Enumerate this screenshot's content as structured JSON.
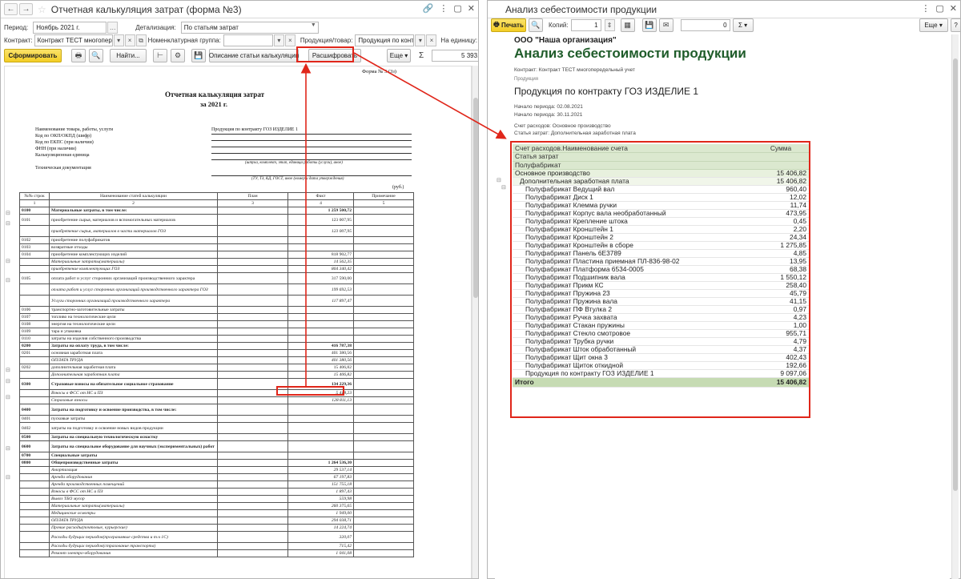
{
  "left_window": {
    "title": "Отчетная калькуляция затрат (форма №3)",
    "period_label": "Период:",
    "period_value": "Ноябрь 2021 г.",
    "detail_label": "Детализация:",
    "detail_value": "По статьям затрат",
    "contract_label": "Контракт:",
    "contract_value": "Контракт ТЕСТ многоперед",
    "nomgroup_label": "Номенклатурная группа:",
    "nomgroup_value": "",
    "product_label": "Продукция/товар:",
    "product_value": "Продукция по контра",
    "per_unit_label": "На единицу:",
    "generate_button": "Сформировать",
    "find_button": "Найти...",
    "desc_button": "Описание статьи калькуляции",
    "decode_button": "Расшифровать",
    "more_button": "Еще",
    "sum_value": "5 393,70",
    "doc": {
      "form_no": "Форма № 3 (3з)",
      "title1": "Отчетная калькуляция затрат",
      "title2": "за 2021 г.",
      "labels": [
        "Наименование товара, работы, услуги",
        "Код по ОКП/ОКПД (шифр)",
        "Код по ЕКПС (при наличии)",
        "ФНН (при наличии)",
        "Калькуляционная единица",
        "Техническая документация"
      ],
      "product_name": "Продукция по контракту ГОЗ ИЗДЕЛИЕ 1",
      "hint1": "(штука, комплект, этап, единица работы (услуги), иное)",
      "hint2": "(ТУ, ТЗ, КД, ГОСТ, иное (номер и дата утверждения)",
      "rub": "(руб.)",
      "headers": [
        "№№ строк",
        "Наименование статей калькуляции",
        "План",
        "Факт",
        "Примечание"
      ],
      "colnums": [
        "1",
        "2",
        "3",
        "4",
        "5"
      ],
      "rows": [
        {
          "c": "0100",
          "n": "Материальные затраты, в том числе:",
          "f": "1 259 500,72",
          "s": "b"
        },
        {
          "c": "0101",
          "n": "приобретение сырья, материалов и вспомогательных материалов",
          "f": "123 007,95",
          "s": ""
        },
        {
          "c": "",
          "n": "приобретение сырья, материалов в части материалов ГОЗ",
          "f": "123 007,95",
          "s": "i"
        },
        {
          "c": "0102",
          "n": "приобретение полуфабрикатов",
          "f": "",
          "s": ""
        },
        {
          "c": "0103",
          "n": "возвратные отходы",
          "f": "",
          "s": ""
        },
        {
          "c": "0104",
          "n": "приобретение комплектующих изделий",
          "f": "818 902,77",
          "s": ""
        },
        {
          "c": "",
          "n": "Материальные затраты(материалы)",
          "f": "14 562,35",
          "s": "i"
        },
        {
          "c": "",
          "n": "приобретение комплектующих ГОЗ",
          "f": "804 340,42",
          "s": "i"
        },
        {
          "c": "0105",
          "n": "оплата работ и услуг сторонних организаций производственного характера",
          "f": "317 590,00",
          "s": ""
        },
        {
          "c": "",
          "n": "оплата работ и услуг сторонних организаций производственного характера ГОЗ",
          "f": "199 692,53",
          "s": "i"
        },
        {
          "c": "",
          "n": "Услуги сторонних организаций производственного характера",
          "f": "117 897,47",
          "s": "i"
        },
        {
          "c": "0106",
          "n": "транспортно-заготовительные затраты",
          "f": "",
          "s": ""
        },
        {
          "c": "0107",
          "n": "топливо на технологические цели",
          "f": "",
          "s": ""
        },
        {
          "c": "0108",
          "n": "энергия на технологические цели",
          "f": "",
          "s": ""
        },
        {
          "c": "0109",
          "n": "тара и упаковка",
          "f": "",
          "s": ""
        },
        {
          "c": "0110",
          "n": "затраты на изделия собственного производства",
          "f": "",
          "s": ""
        },
        {
          "c": "0200",
          "n": "Затраты на оплату труда, в том числе:",
          "f": "416 787,38",
          "s": "b"
        },
        {
          "c": "0201",
          "n": "основная заработная плата",
          "f": "401 380,56",
          "s": ""
        },
        {
          "c": "",
          "n": "ОПЛАТА ТРУДА",
          "f": "401 380,56",
          "s": "i"
        },
        {
          "c": "0202",
          "n": "дополнительная заработная плата",
          "f": "15 406,82",
          "s": ""
        },
        {
          "c": "",
          "n": "Дополнительная заработная плата",
          "f": "15 406,82",
          "s": "i"
        },
        {
          "c": "0300",
          "n": "Страховые взносы на обязательное социальное страхование",
          "f": "134 229,36",
          "s": "b"
        },
        {
          "c": "",
          "n": "Взносы в ФСС от НС и ПЗ",
          "f": "5 418,23",
          "s": "i"
        },
        {
          "c": "",
          "n": "Страховые взносы",
          "f": "128 811,13",
          "s": "i"
        },
        {
          "c": "0400",
          "n": "Затраты на подготовку и освоение производства, в том числе:",
          "f": "",
          "s": "b"
        },
        {
          "c": "0401",
          "n": "пусковые затраты",
          "f": "",
          "s": ""
        },
        {
          "c": "0402",
          "n": "затраты на подготовку и освоение новых видов продукции",
          "f": "",
          "s": ""
        },
        {
          "c": "0500",
          "n": "Затраты на специальную технологическую оснастку",
          "f": "",
          "s": "b"
        },
        {
          "c": "0600",
          "n": "Затраты на специальное оборудование для научных (экспериментальных) работ",
          "f": "",
          "s": "b"
        },
        {
          "c": "0700",
          "n": "Специальные затраты",
          "f": "",
          "s": "b"
        },
        {
          "c": "0800",
          "n": "Общепроизводственные затраты",
          "f": "1 264 536,30",
          "s": "b"
        },
        {
          "c": "",
          "n": "Амортизация",
          "f": "29 537,14",
          "s": "i"
        },
        {
          "c": "",
          "n": "Аренда оборудования",
          "f": "67 197,83",
          "s": "i"
        },
        {
          "c": "",
          "n": "Аренда производственных помещений",
          "f": "151 755,18",
          "s": "i"
        },
        {
          "c": "",
          "n": "Взносы в ФСС от НС и ПЗ",
          "f": "1 897,43",
          "s": "i"
        },
        {
          "c": "",
          "n": "Вывоз ТБО мусор",
          "f": "559,98",
          "s": "i"
        },
        {
          "c": "",
          "n": "Материальные затраты(материалы)",
          "f": "260 375,65",
          "s": "i"
        },
        {
          "c": "",
          "n": "Медицинские осмотры",
          "f": "1 949,00",
          "s": "i"
        },
        {
          "c": "",
          "n": "ОПЛАТА ТРУДА",
          "f": "294 038,71",
          "s": "i"
        },
        {
          "c": "",
          "n": "Прочие расходы(почтовые, курьерские)",
          "f": "14 224,74",
          "s": "i"
        },
        {
          "c": "",
          "n": "Расходы будущих периодов(программные средства и т.ч 1С)",
          "f": "320,07",
          "s": "i"
        },
        {
          "c": "",
          "n": "Расходы будущих периодов(страхование транспорта)",
          "f": "715,42",
          "s": "i"
        },
        {
          "c": "",
          "n": "Ремонт электро-оборудования",
          "f": "1 041,08",
          "s": "i"
        }
      ]
    }
  },
  "right_window": {
    "title": "Анализ себестоимости продукции",
    "print_button": "Печать",
    "copies_label": "Копий:",
    "copies_value": "1",
    "num_value": "0",
    "sigma": "Σ",
    "more_button": "Еще",
    "report": {
      "org": "ООО \"Наша организация\"",
      "title": "Анализ себестоимости продукции",
      "contract": "Контракт: Контракт ТЕСТ многопередельный учет",
      "product_caption": "Продукция",
      "product_name": "Продукция по контракту ГОЗ ИЗДЕЛИЕ 1",
      "period_start": "Начало периода: 02.08.2021",
      "period_end": "Начало периода: 30.11.2021",
      "account": "Счет расходов: Основное производство",
      "cost_item": "Статья затрат: Дополнительная заработная плата",
      "headers": [
        "Счет расходов.Наименование счета",
        "Статья затрат",
        "Полуфабрикат"
      ],
      "sum_header": "Сумма",
      "group1": {
        "name": "Основное производство",
        "sum": "15 406,82"
      },
      "group2": {
        "name": "Дополнительная заработная плата",
        "sum": "15 406,82"
      },
      "items": [
        {
          "n": "Полуфабрикат Ведущий вал",
          "s": "960,40"
        },
        {
          "n": "Полуфабрикат Диск 1",
          "s": "12,02"
        },
        {
          "n": "Полуфабрикат Клемма ручки",
          "s": "11,74"
        },
        {
          "n": "Полуфабрикат Корпус вала необработанный",
          "s": "473,95"
        },
        {
          "n": "Полуфабрикат Крепление штока",
          "s": "0,45"
        },
        {
          "n": "Полуфабрикат Кронштейн 1",
          "s": "2,20"
        },
        {
          "n": "Полуфабрикат Кронштейн 2",
          "s": "24,34"
        },
        {
          "n": "Полуфабрикат Кронштейн в сборе",
          "s": "1 275,85"
        },
        {
          "n": "Полуфабрикат Панель 6Е3789",
          "s": "4,85"
        },
        {
          "n": "Полуфабрикат Пластина приемная ПЛ-836-98-02",
          "s": "13,95"
        },
        {
          "n": "Полуфабрикат Платформа 6534-0005",
          "s": "68,38"
        },
        {
          "n": "Полуфабрикат Подшипник вала",
          "s": "1 550,12"
        },
        {
          "n": "Полуфабрикат Прикм КС",
          "s": "258,40"
        },
        {
          "n": "Полуфабрикат Пружина 23",
          "s": "45,79"
        },
        {
          "n": "Полуфабрикат Пружина вала",
          "s": "41,15"
        },
        {
          "n": "Полуфабрикат ПФ Втулка 2",
          "s": "0,97"
        },
        {
          "n": "Полуфабрикат Ручка захвата",
          "s": "4,23"
        },
        {
          "n": "Полуфабрикат Стакан пружины",
          "s": "1,00"
        },
        {
          "n": "Полуфабрикат Стекло смотровое",
          "s": "955,71"
        },
        {
          "n": "Полуфабрикат Трубка ручки",
          "s": "4,79"
        },
        {
          "n": "Полуфабрикат Шток обработанный",
          "s": "4,37"
        },
        {
          "n": "Полуфабрикат Щит окна 3",
          "s": "402,43"
        },
        {
          "n": "Полуфабрикат Щиток откидной",
          "s": "192,66"
        },
        {
          "n": "Продукция по контракту ГОЗ ИЗДЕЛИЕ 1",
          "s": "9 097,06"
        }
      ],
      "total_label": "Итого",
      "total_sum": "15 406,82"
    }
  },
  "colors": {
    "accent_red": "#e0261a",
    "button_yellow": "#f3cd25",
    "report_green": "#dbe8cf",
    "title_green": "#1f5c2a"
  }
}
